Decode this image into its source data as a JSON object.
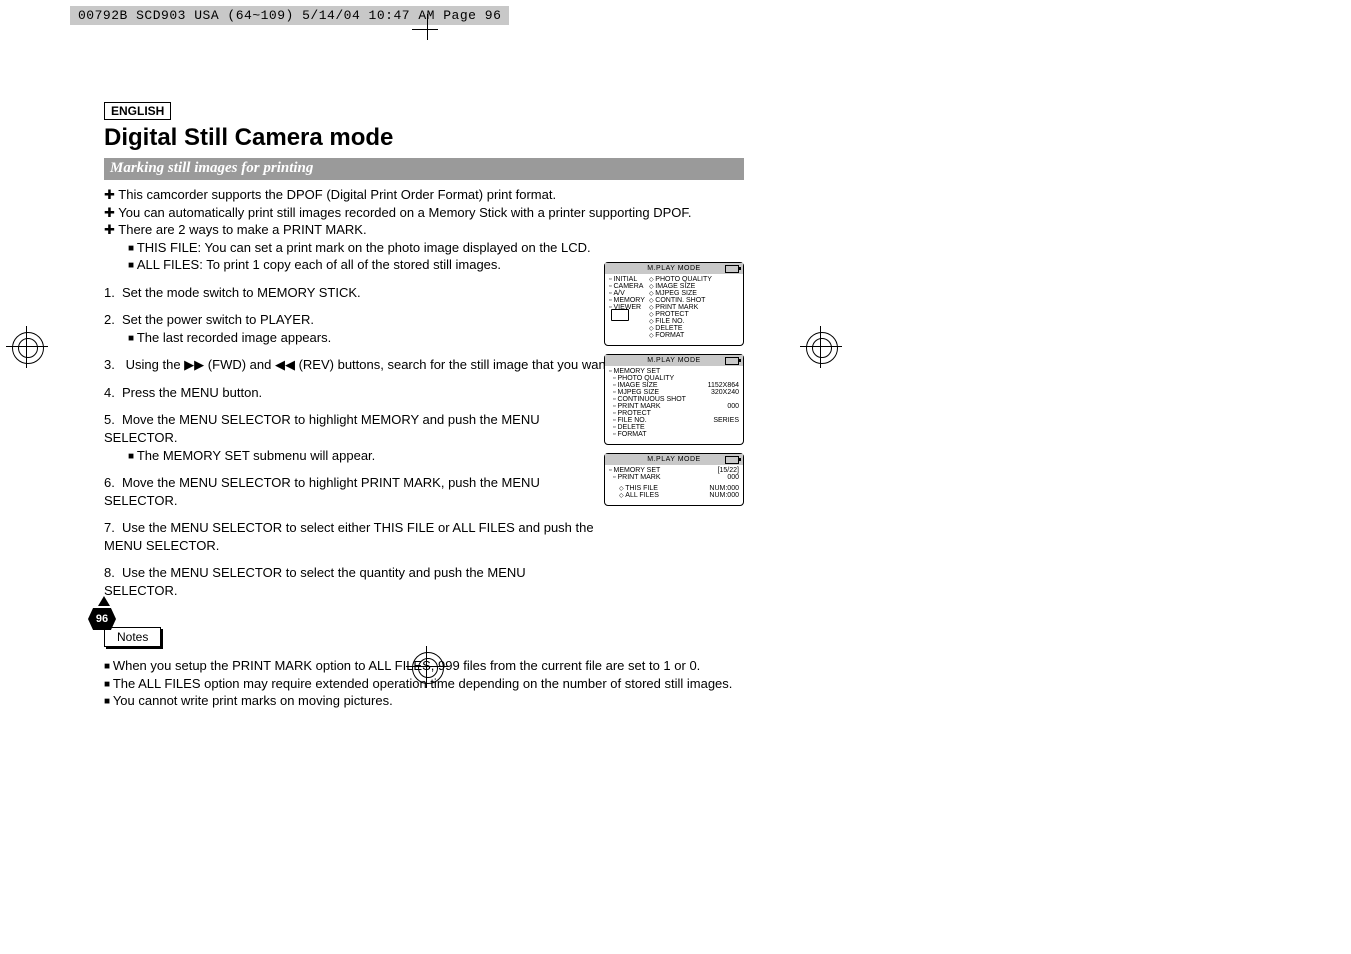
{
  "print_header": "00792B SCD903 USA (64~109)  5/14/04 10:47 AM  Page 96",
  "lang_label": "ENGLISH",
  "title": "Digital Still Camera mode",
  "section_title": "Marking still images for printing",
  "intro": {
    "p1": "This camcorder supports the DPOF (Digital Print Order Format) print format.",
    "p2": "You can automatically print still images recorded on a Memory Stick with a printer supporting DPOF.",
    "p3": "There are 2 ways to make a PRINT MARK.",
    "p3a": "THIS FILE: You can set a print mark on the photo image displayed on the LCD.",
    "p3b": "ALL FILES: To print 1 copy each of all of the stored still images."
  },
  "steps": {
    "s1": "Set the mode switch to MEMORY STICK.",
    "s2": "Set the power switch to PLAYER.",
    "s2a": "The last recorded image appears.",
    "s3a": "Using the ",
    "s3b": " (FWD) and  ",
    "s3c": "(REV) buttons, search for the still image that you want to mark.",
    "s4": "Press the MENU button.",
    "s5": "Move the MENU SELECTOR to highlight MEMORY and push the MENU SELECTOR.",
    "s5a": "The MEMORY SET submenu will appear.",
    "s6": "Move the MENU SELECTOR to highlight PRINT MARK, push the MENU SELECTOR.",
    "s7": "Use the MENU SELECTOR to select either THIS FILE or ALL FILES and push the MENU SELECTOR.",
    "s8": "Use the MENU SELECTOR to select the quantity and push the MENU SELECTOR."
  },
  "notes_label": "Notes",
  "notes": {
    "n1": "When you setup the PRINT MARK option to ALL FILES, 999 files from the current file are set to 1 or 0.",
    "n2": "The ALL FILES option may require extended operation time depending on the number of stored still images.",
    "n3": "You cannot write print marks on moving pictures."
  },
  "page_number": "96",
  "screen_header": "M.PLAY  MODE",
  "screen1": {
    "left": {
      "l1": "INITIAL",
      "l2": "CAMERA",
      "l3": "A/V",
      "l4": "MEMORY",
      "l5": "VIEWER"
    },
    "right": {
      "r1": "PHOTO QUALITY",
      "r2": "IMAGE SIZE",
      "r3": "MJPEG SIZE",
      "r4": "CONTIN. SHOT",
      "r5": "PRINT MARK",
      "r6": "PROTECT",
      "r7": "FILE NO.",
      "r8": "DELETE",
      "r9": "FORMAT"
    }
  },
  "screen2": {
    "title": "MEMORY SET",
    "rows": {
      "r1l": "PHOTO QUALITY",
      "r1r": "",
      "r2l": "IMAGE SIZE",
      "r2r": "1152X864",
      "r3l": "MJPEG SIZE",
      "r3r": "320X240",
      "r4l": "CONTINUOUS SHOT",
      "r4r": "",
      "r5l": "PRINT MARK",
      "r5r": "000",
      "r6l": "PROTECT",
      "r6r": "",
      "r7l": "FILE NO.",
      "r7r": "SERIES",
      "r8l": "DELETE",
      "r8r": "",
      "r9l": "FORMAT",
      "r9r": ""
    }
  },
  "screen3": {
    "title": "MEMORY SET",
    "counter": "[15/22]",
    "zeros": "000",
    "sub": "PRINT MARK",
    "row1l": "THIS FILE",
    "row1r": "NUM:000",
    "row2l": "ALL FILES",
    "row2r": "NUM:000"
  },
  "icons": {
    "ff": "▶▶",
    "rw": "◀◀"
  }
}
